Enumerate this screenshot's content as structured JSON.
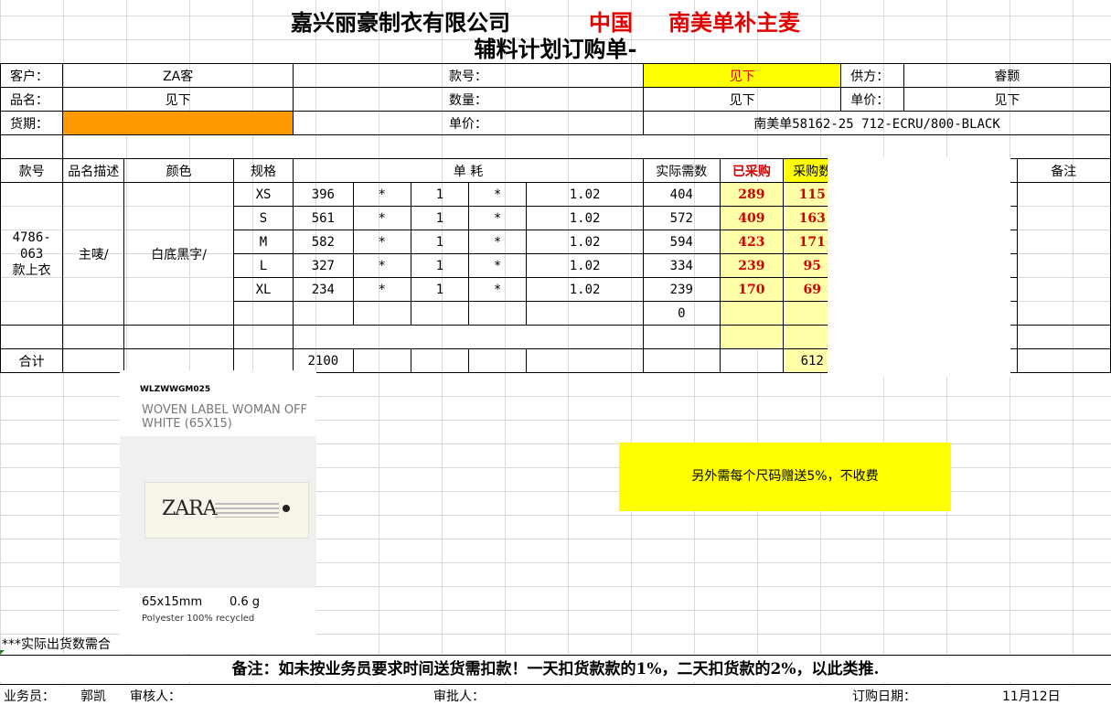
{
  "title": {
    "company": "嘉兴丽豪制衣有限公司",
    "red1": "中国",
    "red2": "南美单补主麦",
    "subtitle": "辅料计划订购单-"
  },
  "info": {
    "customer_label": "客户：",
    "customer": "ZA客",
    "style_label": "款号：",
    "style_value": "见下",
    "supplier_label": "供方：",
    "supplier": "睿颢",
    "product_label": "品名：",
    "product": "见下",
    "qty_label": "数量：",
    "qty": "见下",
    "unitprice_label": "单价：",
    "unitprice": "见下",
    "delivery_label": "货期：",
    "price_label": "单价：",
    "order_note": "南美单58162-25 712-ECRU/800-BLACK"
  },
  "table": {
    "headers": [
      "款号",
      "品名描述",
      "颜色",
      "规格",
      "单 耗",
      "实际需数",
      "已采购",
      "采购数",
      "备注"
    ],
    "style_no": "4786-063",
    "style_sub": "款上衣",
    "desc": "主唛/",
    "color": "白底黑字/",
    "rows": [
      {
        "size": "XS",
        "qty": "396",
        "m1": "*",
        "c": "1",
        "m2": "*",
        "f": "1.02",
        "need": "404",
        "bought": "289",
        "buy": "115"
      },
      {
        "size": "S",
        "qty": "561",
        "m1": "*",
        "c": "1",
        "m2": "*",
        "f": "1.02",
        "need": "572",
        "bought": "409",
        "buy": "163"
      },
      {
        "size": "M",
        "qty": "582",
        "m1": "*",
        "c": "1",
        "m2": "*",
        "f": "1.02",
        "need": "594",
        "bought": "423",
        "buy": "171"
      },
      {
        "size": "L",
        "qty": "327",
        "m1": "*",
        "c": "1",
        "m2": "*",
        "f": "1.02",
        "need": "334",
        "bought": "239",
        "buy": "95"
      },
      {
        "size": "XL",
        "qty": "234",
        "m1": "*",
        "c": "1",
        "m2": "*",
        "f": "1.02",
        "need": "239",
        "bought": "170",
        "buy": "69"
      }
    ],
    "extra_need": "0",
    "total_label": "合计",
    "total_qty": "2100",
    "total_buy": "612"
  },
  "label_card": {
    "code": "WLZWWGM025",
    "name": "WOVEN LABEL WOMAN OFF WHITE (65X15)",
    "logo": "ZARA",
    "dims": "65x15mm",
    "weight": "0.6 g",
    "material": "Polyester 100% recycled"
  },
  "note_yellow": "另外需每个尺码赠送5%，不收费",
  "stars_note": "***实际出货数需合",
  "remark": "备注：如未按业务员要求时间送货需扣款！一天扣货款款的1%，二天扣货款的2%，以此类推.",
  "footer": {
    "salesman_label": "业务员：",
    "salesman": "郭凯",
    "reviewer_label": "审核人：",
    "approver_label": "审批人：",
    "date_label": "订购日期：",
    "date": "11月12日"
  }
}
